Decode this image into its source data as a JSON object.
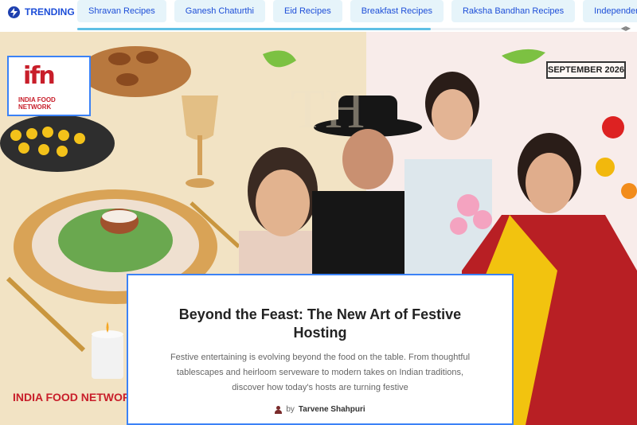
{
  "trending": {
    "label": "TRENDING",
    "icon": "lightning-icon",
    "items": [
      "Shravan Recipes",
      "Ganesh Chaturthi",
      "Eid Recipes",
      "Breakfast Recipes",
      "Raksha Bandhan Recipes",
      "Independence d"
    ]
  },
  "hero": {
    "logo_mark": "ifn",
    "logo_text_line1": "INDIA FOOD",
    "logo_text_line2": "NETWORK",
    "date_badge": "SEPTEMBER 2026",
    "brand_footer": "INDIA FOOD NETWORK"
  },
  "article": {
    "title": "Beyond the Feast: The New Art of Festive Hosting",
    "description": "Festive entertaining is evolving beyond the food on the table. From thoughtful tablescapes and heirloom serveware to modern takes on Indian traditions, discover how today's hosts are turning festive",
    "by": "by",
    "author": "Tarvene Shahpuri"
  },
  "colors": {
    "accent": "#1d4ed8",
    "brand_red": "#c81e2a",
    "chip_bg": "#e6f4fa",
    "focus_border": "#3b82f6"
  }
}
